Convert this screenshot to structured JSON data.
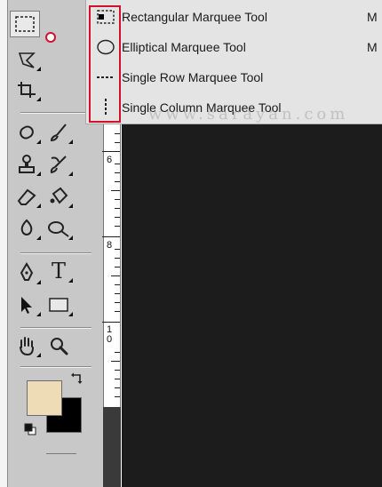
{
  "toolbox": {
    "tools": [
      {
        "name": "marquee-tool-icon",
        "active": true
      },
      {
        "name": "lasso-tool-icon"
      },
      {
        "name": "crop-tool-icon"
      },
      {
        "name": "healing-brush-tool-icon"
      },
      {
        "name": "brush-tool-icon"
      },
      {
        "name": "clone-stamp-tool-icon"
      },
      {
        "name": "history-brush-tool-icon"
      },
      {
        "name": "eraser-tool-icon"
      },
      {
        "name": "paint-bucket-tool-icon"
      },
      {
        "name": "blur-tool-icon"
      },
      {
        "name": "dodge-tool-icon"
      },
      {
        "name": "pen-tool-icon"
      },
      {
        "name": "type-tool-icon",
        "glyph": "T"
      },
      {
        "name": "path-selection-tool-icon"
      },
      {
        "name": "rectangle-shape-tool-icon"
      },
      {
        "name": "hand-tool-icon"
      },
      {
        "name": "zoom-tool-icon"
      }
    ],
    "colors": {
      "foreground": "#eddcb6",
      "background": "#000000"
    }
  },
  "menu": {
    "items": [
      {
        "label": "Rectangular Marquee Tool",
        "shortcut": "M",
        "selected": true,
        "icon": "rectangular-marquee-icon"
      },
      {
        "label": "Elliptical Marquee Tool",
        "shortcut": "M",
        "selected": false,
        "icon": "elliptical-marquee-icon"
      },
      {
        "label": "Single Row Marquee Tool",
        "shortcut": "",
        "selected": false,
        "icon": "single-row-marquee-icon"
      },
      {
        "label": "Single Column Marquee Tool",
        "shortcut": "",
        "selected": false,
        "icon": "single-column-marquee-icon"
      }
    ],
    "highlight_color": "#d3112a"
  },
  "ruler": {
    "numbers": [
      "6",
      "8",
      "1\n0"
    ]
  },
  "watermark": "www.sarayan.com"
}
